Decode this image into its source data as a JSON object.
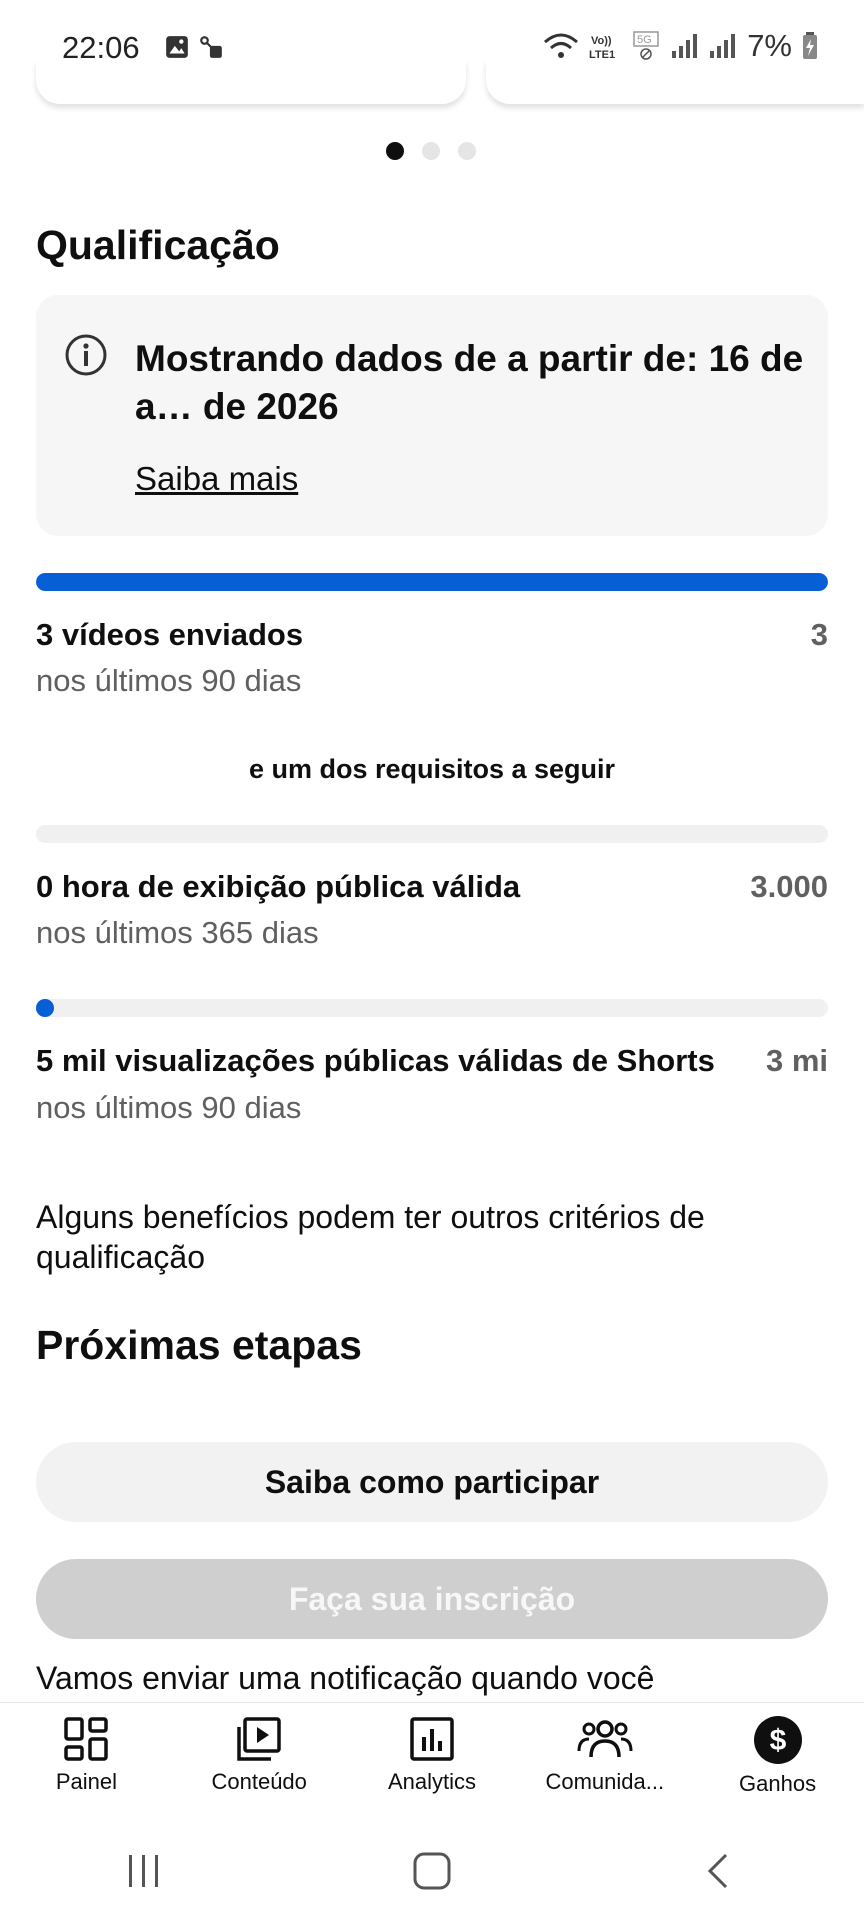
{
  "status_bar": {
    "time": "22:06",
    "battery": "7%"
  },
  "carousel": {
    "dots": 3,
    "active": 0
  },
  "qualification": {
    "title": "Qualificação",
    "info": {
      "text": "Mostrando dados de a partir de: 16 de a… de 2026",
      "link": "Saiba mais"
    },
    "requirements": [
      {
        "label": "3 vídeos enviados",
        "sub": "nos últimos 90 dias",
        "target": "3",
        "progress_percent": 100
      },
      {
        "label": "0 hora de exibição pública válida",
        "sub": "nos últimos 365 dias",
        "target": "3.000",
        "progress_percent": 0
      },
      {
        "label": "5 mil visualizações públicas válidas de Shorts",
        "sub": "nos últimos 90 dias",
        "target": "3 mi",
        "progress_percent": 0.2
      }
    ],
    "middle_note": "e um dos requisitos a seguir",
    "benefit_note": "Alguns benefícios podem ter outros critérios de qualificação"
  },
  "next_steps": {
    "title": "Próximas etapas",
    "learn_button": "Saiba como participar",
    "apply_button": "Faça sua inscrição",
    "notice": "Vamos enviar uma notificação quando você"
  },
  "nav": {
    "items": [
      {
        "label": "Painel",
        "icon": "dashboard-icon"
      },
      {
        "label": "Conteúdo",
        "icon": "content-icon"
      },
      {
        "label": "Analytics",
        "icon": "analytics-icon"
      },
      {
        "label": "Comunida...",
        "icon": "community-icon"
      },
      {
        "label": "Ganhos",
        "icon": "earn-icon"
      }
    ]
  },
  "colors": {
    "accent": "#065fd4"
  }
}
